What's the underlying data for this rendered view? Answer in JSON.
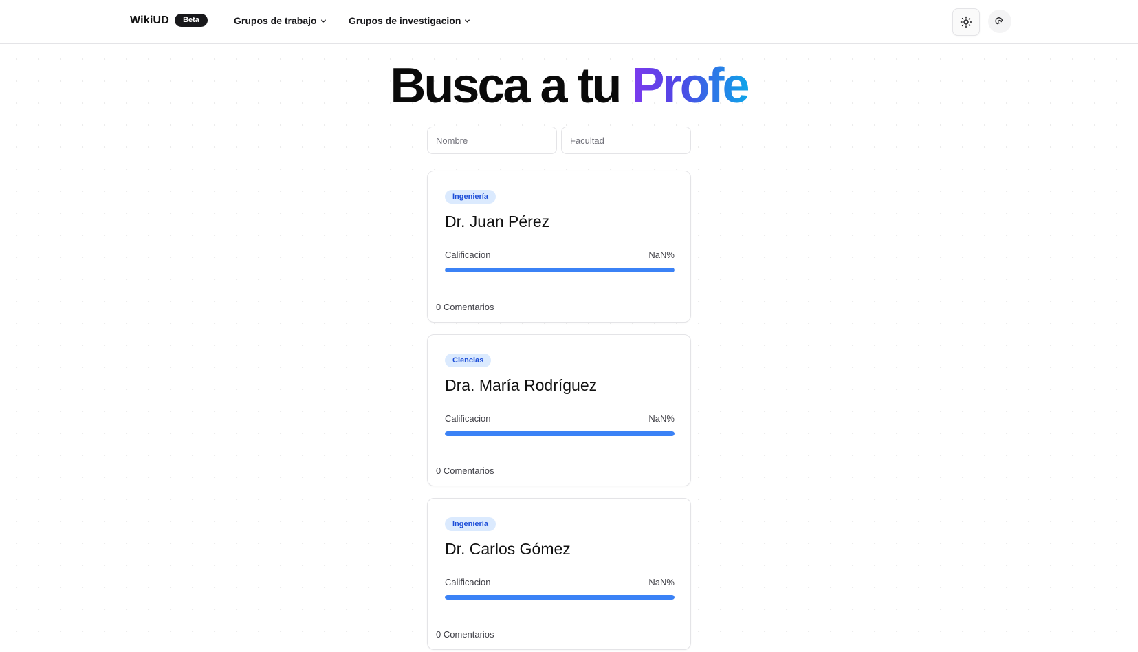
{
  "navbar": {
    "brand": "WikiUD",
    "badge": "Beta",
    "links": [
      {
        "label": "Grupos de trabajo"
      },
      {
        "label": "Grupos de investigacion"
      }
    ],
    "icons": [
      "sun-icon",
      "fingerprint-icon"
    ]
  },
  "hero": {
    "title_main": "Busca a tu ",
    "title_accent": "Profe"
  },
  "search": {
    "name_placeholder": "Nombre",
    "name_value": "",
    "faculty_placeholder": "Facultad",
    "faculty_value": ""
  },
  "colors": {
    "accent_gradient": [
      "#7c3aed",
      "#0ea5e9"
    ],
    "progress": "#3b82f6",
    "tag_bg": "#dbeafe",
    "tag_text": "#1d4ed8"
  },
  "professors": [
    {
      "faculty": "Ingeniería",
      "name": "Dr. Juan Pérez",
      "rating_label": "Calificacion",
      "rating_value": "NaN%",
      "rating_fill": 1.0,
      "comments": "0 Comentarios"
    },
    {
      "faculty": "Ciencias",
      "name": "Dra. María Rodríguez",
      "rating_label": "Calificacion",
      "rating_value": "NaN%",
      "rating_fill": 1.0,
      "comments": "0 Comentarios"
    },
    {
      "faculty": "Ingeniería",
      "name": "Dr. Carlos Gómez",
      "rating_label": "Calificacion",
      "rating_value": "NaN%",
      "rating_fill": 1.0,
      "comments": "0 Comentarios"
    }
  ]
}
